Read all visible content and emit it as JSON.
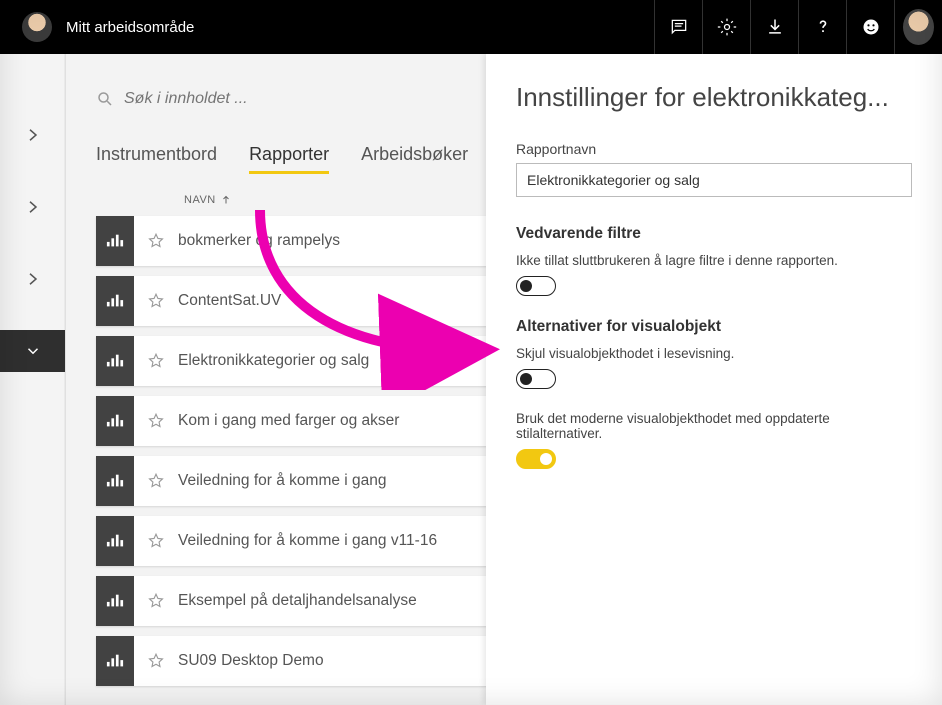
{
  "topbar": {
    "workspace": "Mitt arbeidsområde"
  },
  "search": {
    "placeholder": "Søk i innholdet ..."
  },
  "tabs": {
    "dashboard": "Instrumentbord",
    "reports": "Rapporter",
    "workbooks": "Arbeidsbøker"
  },
  "columns": {
    "name": "NAVN"
  },
  "reports": [
    {
      "name": "bokmerker og rampelys"
    },
    {
      "name": "ContentSat.UV"
    },
    {
      "name": "Elektronikkategorier og salg"
    },
    {
      "name": "Kom i gang med farger og akser"
    },
    {
      "name": "Veiledning for å komme i gang"
    },
    {
      "name": "Veiledning for å komme i gang v11-16"
    },
    {
      "name": "Eksempel på detaljhandelsanalyse"
    },
    {
      "name": "SU09 Desktop Demo"
    }
  ],
  "panel": {
    "title": "Innstillinger for elektronikkateg...",
    "report_name_label": "Rapportnavn",
    "report_name_value": "Elektronikkategorier og salg",
    "persistent_filters_heading": "Vedvarende filtre",
    "persistent_filters_text": "Ikke tillat sluttbrukeren å lagre filtre i denne rapporten.",
    "visual_options_heading": "Alternativer for visualobjekt",
    "hide_visual_header_text": "Skjul visualobjekthodet i lesevisning.",
    "modern_header_text": "Bruk det moderne visualobjekthodet med oppdaterte stilalternativer."
  }
}
